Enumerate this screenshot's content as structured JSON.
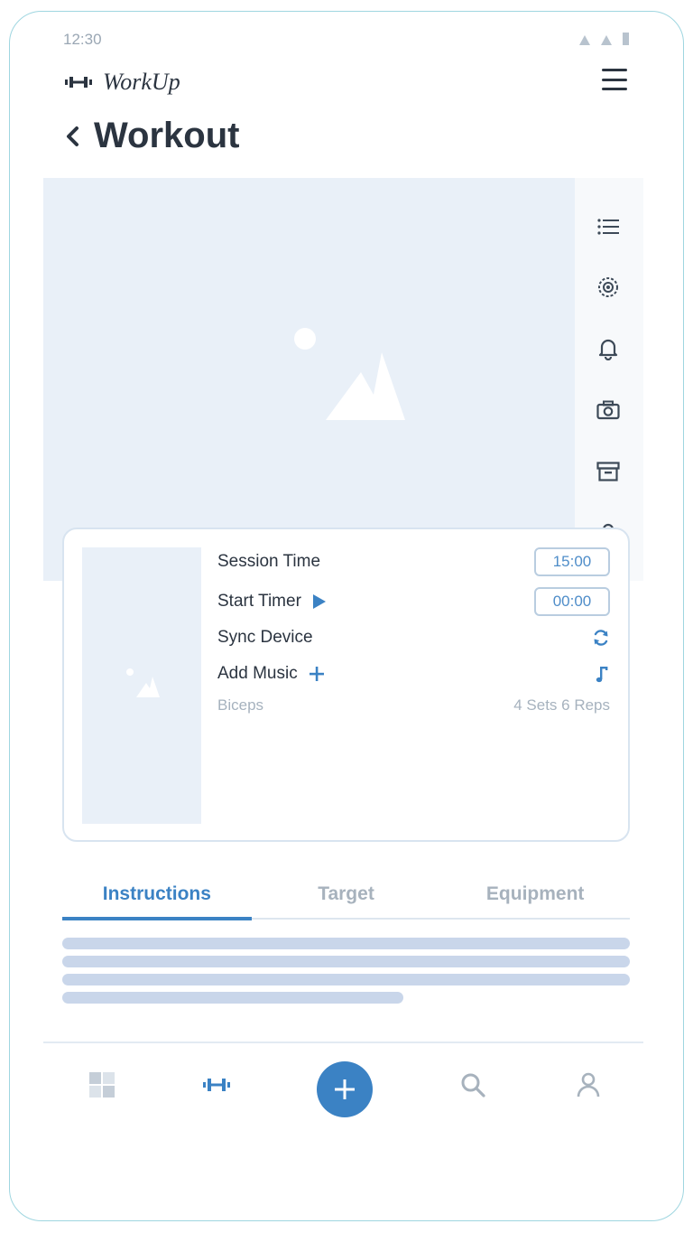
{
  "status_bar": {
    "time": "12:30"
  },
  "app": {
    "name": "WorkUp"
  },
  "page": {
    "title": "Workout"
  },
  "side_rail": {
    "icons": [
      "list-icon",
      "target-icon",
      "bell-icon",
      "camera-icon",
      "archive-icon",
      "user-icon"
    ]
  },
  "session": {
    "session_time_label": "Session Time",
    "session_time_value": "15:00",
    "start_timer_label": "Start Timer",
    "start_timer_value": "00:00",
    "sync_label": "Sync Device",
    "music_label": "Add Music",
    "muscle": "Biceps",
    "sets_reps": "4 Sets 6 Reps"
  },
  "tabs": [
    {
      "label": "Instructions",
      "active": true
    },
    {
      "label": "Target",
      "active": false
    },
    {
      "label": "Equipment",
      "active": false
    }
  ],
  "bottom_nav": {
    "items": [
      "dashboard-icon",
      "dumbbell-icon",
      "add-icon",
      "search-icon",
      "profile-icon"
    ],
    "active": "dumbbell-icon"
  },
  "colors": {
    "accent": "#3b82c4",
    "text": "#2b3440",
    "muted": "#a7b2bd",
    "placeholder_bg": "#e9f0f8",
    "frame_border": "#9fd6e0"
  }
}
